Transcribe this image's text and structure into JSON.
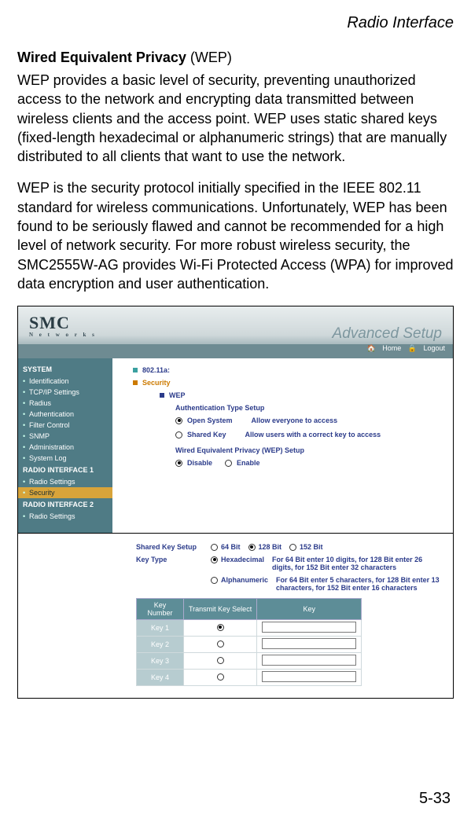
{
  "page": {
    "header": "Radio Interface",
    "title_bold": "Wired Equivalent Privacy",
    "title_rest": " (WEP)",
    "para1": "WEP provides a basic level of security, preventing unauthorized access to the network and encrypting data transmitted between wireless clients and the access point. WEP uses static shared keys (fixed-length hexadecimal or alphanumeric strings) that are manually distributed to all clients that want to use the network.",
    "para2": "WEP is the security protocol initially specified in the IEEE 802.11 standard for wireless communications. Unfortunately, WEP has been found to be seriously flawed and cannot be recommended for a high level of network security. For more robust wireless security, the SMC2555W-AG provides Wi-Fi Protected Access (WPA) for improved data encryption and user authentication.",
    "page_number": "5-33"
  },
  "screenshot1": {
    "logo": "SMC",
    "logo_sub": "N e t w o r k s",
    "adv": "Advanced Setup",
    "home": "Home",
    "logout": "Logout",
    "sidebar": {
      "system": "SYSTEM",
      "items1": [
        "Identification",
        "TCP/IP Settings",
        "Radius",
        "Authentication",
        "Filter Control",
        "SNMP",
        "Administration",
        "System Log"
      ],
      "ri1": "RADIO INTERFACE 1",
      "items2": [
        "Radio Settings"
      ],
      "security": "Security",
      "ri2": "RADIO INTERFACE 2",
      "items3": [
        "Radio Settings"
      ]
    },
    "main": {
      "l1": "802.11a:",
      "l2": "Security",
      "l3": "WEP",
      "auth_title": "Authentication Type Setup",
      "open_system": "Open System",
      "open_desc": "Allow everyone to access",
      "shared_key": "Shared Key",
      "shared_desc": "Allow users with a correct key to access",
      "wep_title": "Wired Equivalent Privacy (WEP) Setup",
      "disable": "Disable",
      "enable": "Enable"
    }
  },
  "screenshot2": {
    "shared_label": "Shared Key Setup",
    "b64": "64 Bit",
    "b128": "128 Bit",
    "b152": "152 Bit",
    "keytype_label": "Key Type",
    "hex": "Hexadecimal",
    "hex_desc": "For 64 Bit enter 10 digits, for 128 Bit enter 26 digits, for 152 Bit enter 32 characters",
    "alpha": "Alphanumeric",
    "alpha_desc": "For 64 Bit enter 5 characters, for 128 Bit enter 13 characters, for 152 Bit enter 16 characters",
    "th1": "Key Number",
    "th2": "Transmit Key Select",
    "th3": "Key",
    "k1": "Key 1",
    "k2": "Key 2",
    "k3": "Key 3",
    "k4": "Key 4"
  }
}
